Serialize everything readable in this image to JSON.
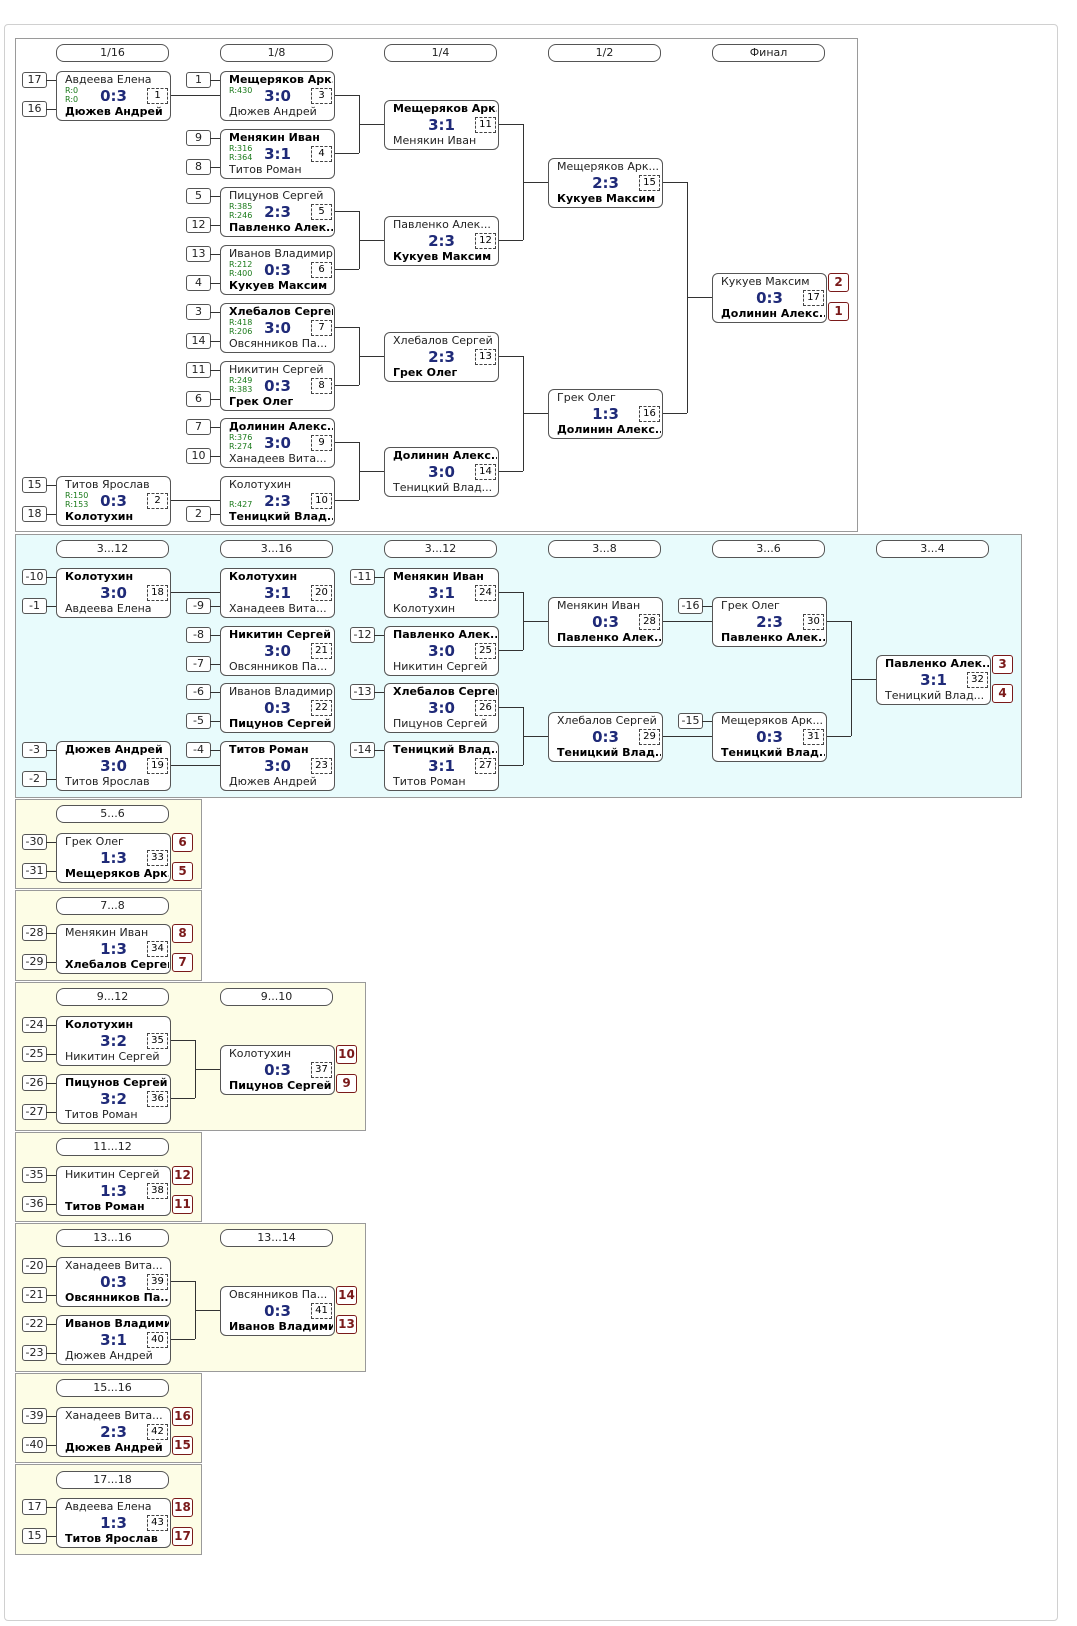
{
  "sections": [
    {
      "id": "main",
      "bg": "#ffffff",
      "rounds": [
        "1/16",
        "1/8",
        "1/4",
        "1/2",
        "Финал"
      ]
    },
    {
      "id": "s3_4",
      "bg": "#e8fbfc",
      "rounds": [
        "3...12",
        "3...16",
        "3...12",
        "3...8",
        "3...6",
        "3...4"
      ]
    },
    {
      "id": "s5_6",
      "bg": "#fdfde6",
      "rounds": [
        "5...6"
      ]
    },
    {
      "id": "s7_8",
      "bg": "#fdfde6",
      "rounds": [
        "7...8"
      ]
    },
    {
      "id": "s9_12",
      "bg": "#fdfde6",
      "rounds": [
        "9...12",
        "9...10"
      ]
    },
    {
      "id": "s11_12",
      "bg": "#fdfde6",
      "rounds": [
        "11...12"
      ]
    },
    {
      "id": "s13_16",
      "bg": "#fdfde6",
      "rounds": [
        "13...16",
        "13...14"
      ]
    },
    {
      "id": "s15_16",
      "bg": "#fdfde6",
      "rounds": [
        "15...16"
      ]
    },
    {
      "id": "s17_18",
      "bg": "#fdfde6",
      "rounds": [
        "17...18"
      ]
    }
  ],
  "matches": [
    {
      "no": "1",
      "p1": "Авдеева Елена",
      "p2": "Дюжев Андрей",
      "score": "0:3",
      "w": 2,
      "r1": "R:0",
      "r2": "R:0",
      "s1": "17",
      "s2": "16"
    },
    {
      "no": "3",
      "p1": "Мещеряков Арк...",
      "p2": "Дюжев Андрей",
      "score": "3:0",
      "w": 1,
      "r1": "R:430",
      "s1": "1"
    },
    {
      "no": "4",
      "p1": "Менякин Иван",
      "p2": "Титов Роман",
      "score": "3:1",
      "w": 1,
      "r1": "R:316",
      "r2": "R:364",
      "s1": "9",
      "s2": "8"
    },
    {
      "no": "5",
      "p1": "Пицунов Сергей",
      "p2": "Павленко Алек...",
      "score": "2:3",
      "w": 2,
      "r1": "R:385",
      "r2": "R:246",
      "s1": "5",
      "s2": "12"
    },
    {
      "no": "6",
      "p1": "Иванов Владимир",
      "p2": "Кукуев Максим",
      "score": "0:3",
      "w": 2,
      "r1": "R:212",
      "r2": "R:400",
      "s1": "13",
      "s2": "4"
    },
    {
      "no": "7",
      "p1": "Хлебалов Сергей",
      "p2": "Овсянников Па...",
      "score": "3:0",
      "w": 1,
      "r1": "R:418",
      "r2": "R:206",
      "s1": "3",
      "s2": "14"
    },
    {
      "no": "8",
      "p1": "Никитин Сергей",
      "p2": "Грек Олег",
      "score": "0:3",
      "w": 2,
      "r1": "R:249",
      "r2": "R:383",
      "s1": "11",
      "s2": "6"
    },
    {
      "no": "9",
      "p1": "Долинин Алекс...",
      "p2": "Ханадеев Вита...",
      "score": "3:0",
      "w": 1,
      "r1": "R:376",
      "r2": "R:274",
      "s1": "7",
      "s2": "10"
    },
    {
      "no": "2",
      "p1": "Титов Ярослав",
      "p2": "Колотухин",
      "score": "0:3",
      "w": 2,
      "r1": "R:150",
      "r2": "R:153",
      "s1": "15",
      "s2": "18"
    },
    {
      "no": "10",
      "p1": "Колотухин",
      "p2": "Теницкий Влад...",
      "score": "2:3",
      "w": 2,
      "r2": "R:427",
      "s2": "2"
    },
    {
      "no": "11",
      "p1": "Мещеряков Арк...",
      "p2": "Менякин Иван",
      "score": "3:1",
      "w": 1
    },
    {
      "no": "12",
      "p1": "Павленко Алек...",
      "p2": "Кукуев Максим",
      "score": "2:3",
      "w": 2
    },
    {
      "no": "13",
      "p1": "Хлебалов Сергей",
      "p2": "Грек Олег",
      "score": "2:3",
      "w": 2
    },
    {
      "no": "14",
      "p1": "Долинин Алекс...",
      "p2": "Теницкий Влад...",
      "score": "3:0",
      "w": 1
    },
    {
      "no": "15",
      "p1": "Мещеряков Арк...",
      "p2": "Кукуев Максим",
      "score": "2:3",
      "w": 2
    },
    {
      "no": "16",
      "p1": "Грек Олег",
      "p2": "Долинин Алекс...",
      "score": "1:3",
      "w": 2
    },
    {
      "no": "17",
      "p1": "Кукуев Максим",
      "p2": "Долинин Алекс...",
      "score": "0:3",
      "w": 2,
      "pl1": "2",
      "pl2": "1"
    },
    {
      "no": "18",
      "p1": "Колотухин",
      "p2": "Авдеева Елена",
      "score": "3:0",
      "w": 1,
      "s1": "-10",
      "s2": "-1"
    },
    {
      "no": "19",
      "p1": "Дюжев Андрей",
      "p2": "Титов Ярослав",
      "score": "3:0",
      "w": 1,
      "s1": "-3",
      "s2": "-2"
    },
    {
      "no": "20",
      "p1": "Колотухин",
      "p2": "Ханадеев Вита...",
      "score": "3:1",
      "w": 1,
      "s2": "-9"
    },
    {
      "no": "21",
      "p1": "Никитин Сергей",
      "p2": "Овсянников Па...",
      "score": "3:0",
      "w": 1,
      "s1": "-8",
      "s2": "-7"
    },
    {
      "no": "22",
      "p1": "Иванов Владимир",
      "p2": "Пицунов Сергей",
      "score": "0:3",
      "w": 2,
      "s1": "-6",
      "s2": "-5"
    },
    {
      "no": "23",
      "p1": "Титов Роман",
      "p2": "Дюжев Андрей",
      "score": "3:0",
      "w": 1,
      "s1": "-4"
    },
    {
      "no": "24",
      "p1": "Менякин Иван",
      "p2": "Колотухин",
      "score": "3:1",
      "w": 1,
      "s1": "-11"
    },
    {
      "no": "25",
      "p1": "Павленко Алек...",
      "p2": "Никитин Сергей",
      "score": "3:0",
      "w": 1,
      "s1": "-12"
    },
    {
      "no": "26",
      "p1": "Хлебалов Сергей",
      "p2": "Пицунов Сергей",
      "score": "3:0",
      "w": 1,
      "s1": "-13"
    },
    {
      "no": "27",
      "p1": "Теницкий Влад...",
      "p2": "Титов Роман",
      "score": "3:1",
      "w": 1,
      "s1": "-14"
    },
    {
      "no": "28",
      "p1": "Менякин Иван",
      "p2": "Павленко Алек...",
      "score": "0:3",
      "w": 2
    },
    {
      "no": "29",
      "p1": "Хлебалов Сергей",
      "p2": "Теницкий Влад...",
      "score": "0:3",
      "w": 2
    },
    {
      "no": "30",
      "p1": "Грек Олег",
      "p2": "Павленко Алек...",
      "score": "2:3",
      "w": 2,
      "s1": "-16"
    },
    {
      "no": "31",
      "p1": "Мещеряков Арк...",
      "p2": "Теницкий Влад...",
      "score": "0:3",
      "w": 2,
      "s1": "-15"
    },
    {
      "no": "32",
      "p1": "Павленко Алек...",
      "p2": "Теницкий Влад...",
      "score": "3:1",
      "w": 1,
      "pl1": "3",
      "pl2": "4"
    },
    {
      "no": "33",
      "p1": "Грек Олег",
      "p2": "Мещеряков Арк...",
      "score": "1:3",
      "w": 2,
      "s1": "-30",
      "s2": "-31",
      "pl1": "6",
      "pl2": "5"
    },
    {
      "no": "34",
      "p1": "Менякин Иван",
      "p2": "Хлебалов Сергей",
      "score": "1:3",
      "w": 2,
      "s1": "-28",
      "s2": "-29",
      "pl1": "8",
      "pl2": "7"
    },
    {
      "no": "35",
      "p1": "Колотухин",
      "p2": "Никитин Сергей",
      "score": "3:2",
      "w": 1,
      "s1": "-24",
      "s2": "-25"
    },
    {
      "no": "36",
      "p1": "Пицунов Сергей",
      "p2": "Титов Роман",
      "score": "3:2",
      "w": 1,
      "s1": "-26",
      "s2": "-27"
    },
    {
      "no": "37",
      "p1": "Колотухин",
      "p2": "Пицунов Сергей",
      "score": "0:3",
      "w": 2,
      "pl1": "10",
      "pl2": "9"
    },
    {
      "no": "38",
      "p1": "Никитин Сергей",
      "p2": "Титов Роман",
      "score": "1:3",
      "w": 2,
      "s1": "-35",
      "s2": "-36",
      "pl1": "12",
      "pl2": "11"
    },
    {
      "no": "39",
      "p1": "Ханадеев Вита...",
      "p2": "Овсянников Па...",
      "score": "0:3",
      "w": 2,
      "s1": "-20",
      "s2": "-21"
    },
    {
      "no": "40",
      "p1": "Иванов Владимир",
      "p2": "Дюжев Андрей",
      "score": "3:1",
      "w": 1,
      "s1": "-22",
      "s2": "-23"
    },
    {
      "no": "41",
      "p1": "Овсянников Па...",
      "p2": "Иванов Владимир",
      "score": "0:3",
      "w": 2,
      "pl1": "14",
      "pl2": "13"
    },
    {
      "no": "42",
      "p1": "Ханадеев Вита...",
      "p2": "Дюжев Андрей",
      "score": "2:3",
      "w": 2,
      "s1": "-39",
      "s2": "-40",
      "pl1": "16",
      "pl2": "15"
    },
    {
      "no": "43",
      "p1": "Авдеева Елена",
      "p2": "Титов Ярослав",
      "score": "1:3",
      "w": 2,
      "s1": "17",
      "s2": "15",
      "pl1": "18",
      "pl2": "17"
    }
  ]
}
